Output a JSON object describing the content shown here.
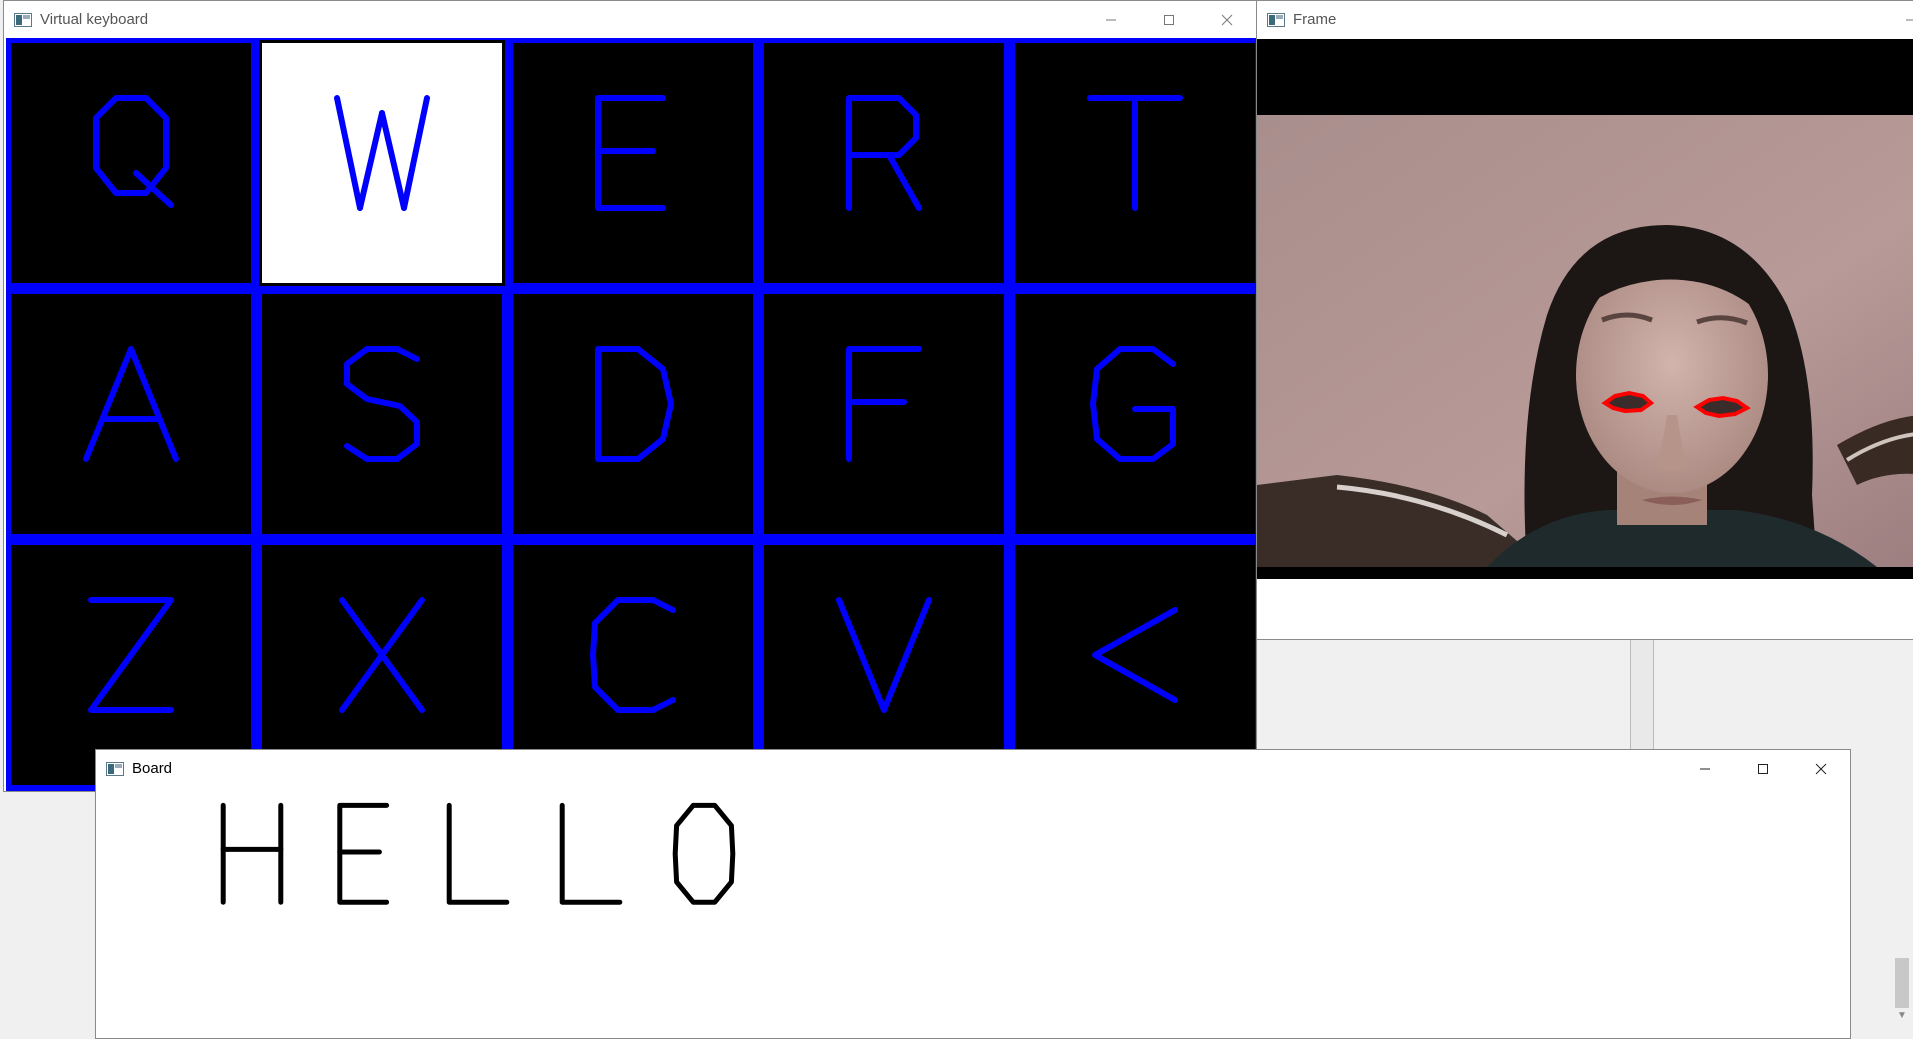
{
  "windows": {
    "keyboard": {
      "title": "Virtual keyboard"
    },
    "frame": {
      "title": "Frame"
    },
    "board": {
      "title": "Board",
      "typed_text": "HELLO"
    }
  },
  "keyboard": {
    "highlighted_key": "W",
    "rows": [
      [
        "Q",
        "W",
        "E",
        "R",
        "T"
      ],
      [
        "A",
        "S",
        "D",
        "F",
        "G"
      ],
      [
        "Z",
        "X",
        "C",
        "V",
        "<"
      ]
    ]
  },
  "colors": {
    "key_letter": "#0000ff",
    "key_border": "#0000ff",
    "key_background": "#000000",
    "key_highlight": "#ffffff",
    "eye_outline": "#ff0000",
    "board_text": "#000000"
  },
  "icons": [
    "app-icon",
    "minimize-icon",
    "maximize-icon",
    "close-icon"
  ]
}
